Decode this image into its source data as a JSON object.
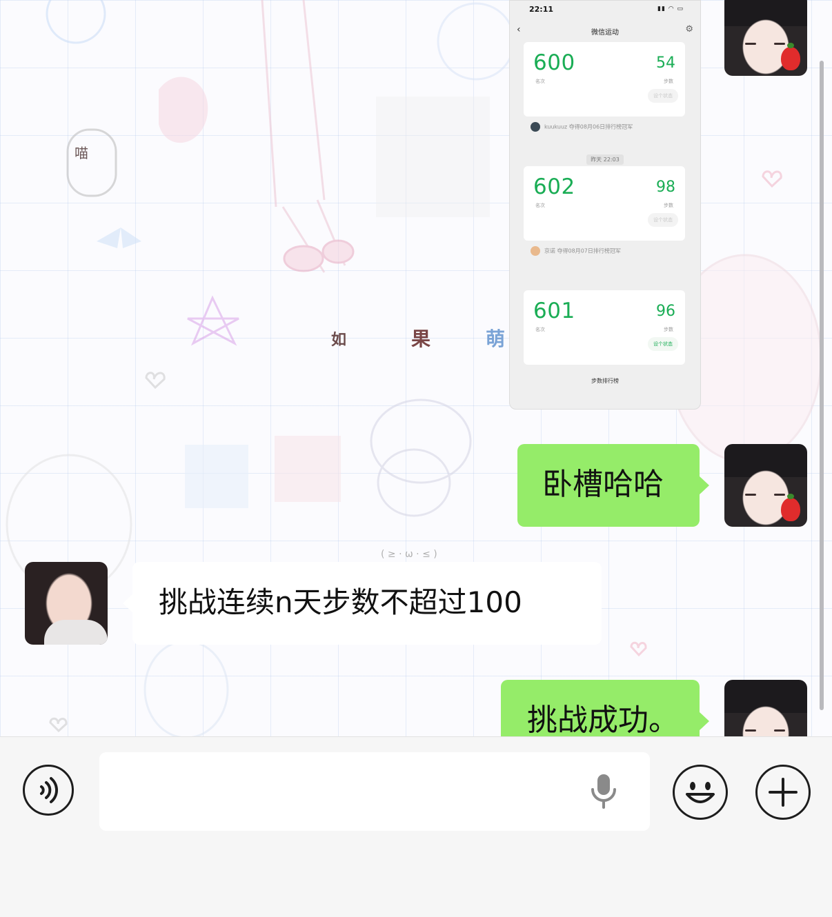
{
  "screenshot": {
    "status_time": "22:11",
    "nav_title": "微信运动",
    "timestamp": "昨天 22:03",
    "cards": [
      {
        "rank": "600",
        "rank_label": "名次",
        "steps": "54",
        "steps_label": "步数",
        "status": "设个状态"
      },
      {
        "rank": "602",
        "rank_label": "名次",
        "steps": "98",
        "steps_label": "步数",
        "status": "设个状态"
      },
      {
        "rank": "601",
        "rank_label": "名次",
        "steps": "96",
        "steps_label": "步数",
        "status": "设个状态"
      }
    ],
    "champions": [
      "kuukuuz 夺得08月06日排行榜冠军",
      "京诺 夺得08月07日排行榜冠军"
    ],
    "footer": "步数排行榜"
  },
  "decor": {
    "meow_sticker": "喵",
    "banner": [
      "如",
      "果",
      "萌"
    ],
    "kaomoji": "( ≥ · ω · ≤ )"
  },
  "messages": [
    {
      "sender": "self",
      "text": "卧槽哈哈"
    },
    {
      "sender": "other",
      "text": "挑战连续n天步数不超过100"
    },
    {
      "sender": "self",
      "text": "挑战成功。"
    }
  ],
  "colors": {
    "my_bubble": "#95ec69",
    "their_bubble": "#ffffff",
    "wechat_green": "#1aad55"
  },
  "icons": [
    "voice-icon",
    "microphone-icon",
    "emoji-icon",
    "plus-icon",
    "back-chevron-icon",
    "gear-icon"
  ]
}
